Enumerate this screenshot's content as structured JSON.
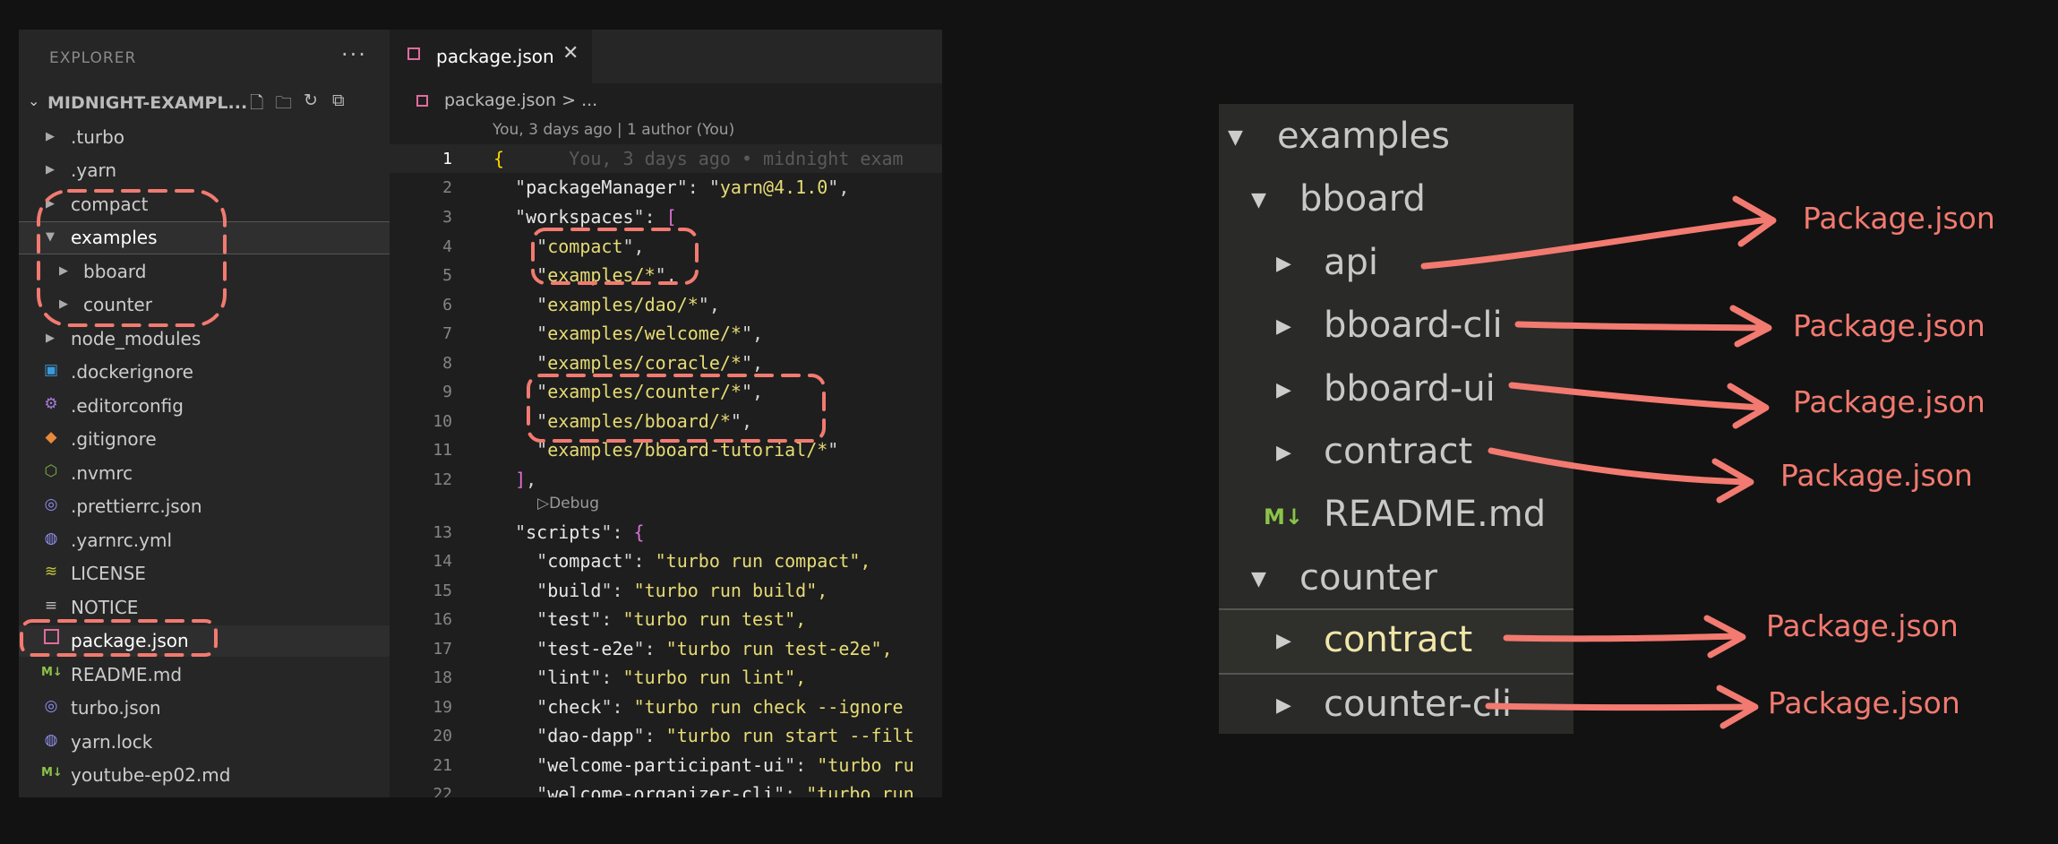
{
  "sidebar": {
    "title": "EXPLORER",
    "more": "···",
    "project": "MIDNIGHT-EXAMPL...",
    "items": [
      {
        "label": ".turbo",
        "type": "folder"
      },
      {
        "label": ".yarn",
        "type": "folder"
      },
      {
        "label": "compact",
        "type": "folder"
      },
      {
        "label": "examples",
        "type": "folder-open"
      },
      {
        "label": "bboard",
        "type": "subfolder"
      },
      {
        "label": "counter",
        "type": "subfolder"
      },
      {
        "label": "node_modules",
        "type": "folder"
      },
      {
        "label": ".dockerignore",
        "type": "docker"
      },
      {
        "label": ".editorconfig",
        "type": "gear"
      },
      {
        "label": ".gitignore",
        "type": "git"
      },
      {
        "label": ".nvmrc",
        "type": "node"
      },
      {
        "label": ".prettierrc.json",
        "type": "prettier"
      },
      {
        "label": ".yarnrc.yml",
        "type": "yarn"
      },
      {
        "label": "LICENSE",
        "type": "license"
      },
      {
        "label": "NOTICE",
        "type": "lines"
      },
      {
        "label": "package.json",
        "type": "npm"
      },
      {
        "label": "README.md",
        "type": "markdown"
      },
      {
        "label": "turbo.json",
        "type": "turbo"
      },
      {
        "label": "yarn.lock",
        "type": "yarn"
      },
      {
        "label": "youtube-ep02.md",
        "type": "markdown"
      }
    ]
  },
  "editor": {
    "tab_label": "package.json",
    "tab_close": "✕",
    "breadcrumb": "package.json > ...",
    "blame": "You, 3 days ago | 1 author (You)",
    "ghost_blame": "You, 3 days ago • midnight exam",
    "codelens": "Debug",
    "lines": [
      {
        "n": "1"
      },
      {
        "n": "2"
      },
      {
        "n": "3"
      },
      {
        "n": "4"
      },
      {
        "n": "5"
      },
      {
        "n": "6"
      },
      {
        "n": "7"
      },
      {
        "n": "8"
      },
      {
        "n": "9"
      },
      {
        "n": "10"
      },
      {
        "n": "11"
      },
      {
        "n": "12"
      },
      {
        "n": "13"
      },
      {
        "n": "14"
      },
      {
        "n": "15"
      },
      {
        "n": "16"
      },
      {
        "n": "17"
      },
      {
        "n": "18"
      },
      {
        "n": "19"
      },
      {
        "n": "20"
      },
      {
        "n": "21"
      },
      {
        "n": "22"
      }
    ],
    "code": {
      "pm_key": "packageManager",
      "pm_val": "yarn@4.1.0",
      "ws_key": "workspaces",
      "ws": [
        "compact",
        "examples/*",
        "examples/dao/*",
        "examples/welcome/*",
        "examples/coracle/*",
        "examples/counter/*",
        "examples/bboard/*",
        "examples/bboard-tutorial/*"
      ],
      "scripts_key": "scripts",
      "scripts": [
        {
          "k": "compact",
          "v": "\"turbo run compact\","
        },
        {
          "k": "build",
          "v": "\"turbo run build\","
        },
        {
          "k": "test",
          "v": "\"turbo run test\","
        },
        {
          "k": "test-e2e",
          "v": "\"turbo run test-e2e\","
        },
        {
          "k": "lint",
          "v": "\"turbo run lint\","
        },
        {
          "k": "check",
          "v": "\"turbo run check --ignore"
        },
        {
          "k": "dao-dapp",
          "v": "\"turbo run start --filt"
        },
        {
          "k": "welcome-participant-ui",
          "v": "\"turbo ru"
        },
        {
          "k": "welcome-organizer-cli",
          "v": "\"turbo run"
        }
      ]
    }
  },
  "tree2": {
    "items": [
      {
        "label": "examples"
      },
      {
        "label": "bboard"
      },
      {
        "label": "api"
      },
      {
        "label": "bboard-cli"
      },
      {
        "label": "bboard-ui"
      },
      {
        "label": "contract"
      },
      {
        "label": "README.md"
      },
      {
        "label": "counter"
      },
      {
        "label": "contract"
      },
      {
        "label": "counter-cli"
      }
    ],
    "md_badge": "M↓"
  },
  "annotations": {
    "labels": [
      "Package.json",
      "Package.json",
      "Package.json",
      "Package.json",
      "Package.json",
      "Package.json"
    ],
    "color": "#f27a70"
  },
  "colors": {
    "background": "#121212",
    "accent_dash": "#f27a70",
    "npm_icon": "#e06c9f"
  }
}
